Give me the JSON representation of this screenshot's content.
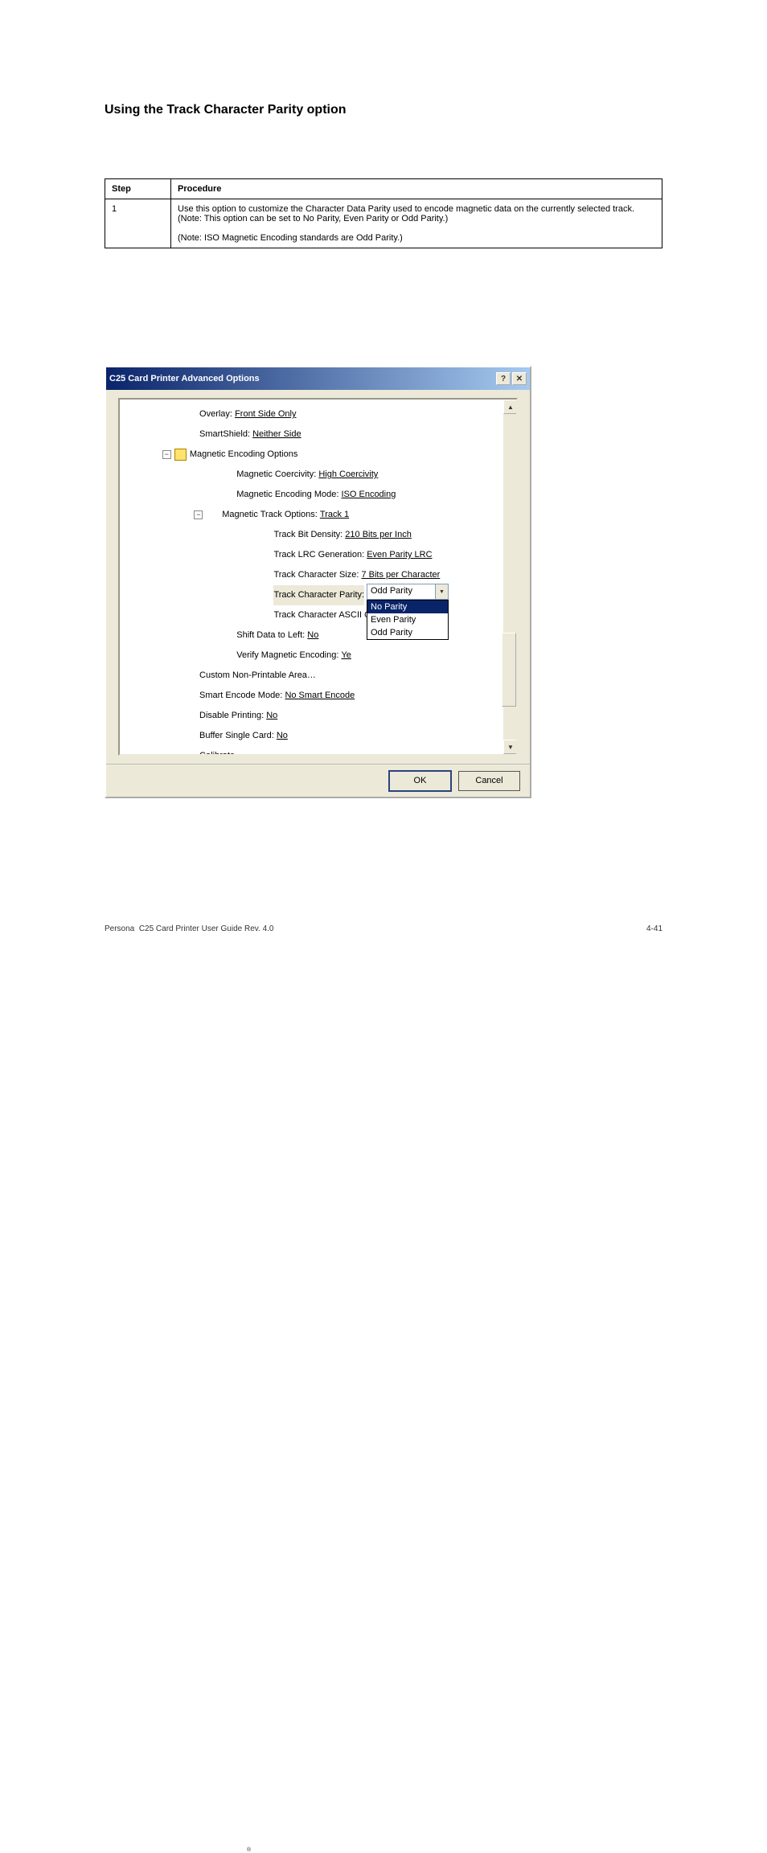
{
  "section": "Using the Track Character Parity option",
  "table": {
    "h1": "Step",
    "h2": "Procedure",
    "c1": "1",
    "c2": "Use this option to customize the Character Data Parity used to encode magnetic data on the currently selected track. (Note: This option can be set to No Parity, Even Parity or Odd Parity.)",
    "note": "(Note: ISO Magnetic Encoding standards are Odd Parity.)"
  },
  "dlg": {
    "title": "C25 Card Printer Advanced Options",
    "tree": {
      "overlay": {
        "l": "Overlay:",
        "v": "Front Side Only"
      },
      "smartshield": {
        "l": "SmartShield:",
        "v": "Neither Side"
      },
      "mag": {
        "l": "Magnetic Encoding Options"
      },
      "coerc": {
        "l": "Magnetic Coercivity:",
        "v": "High Coercivity"
      },
      "mode": {
        "l": "Magnetic Encoding Mode:",
        "v": "ISO Encoding"
      },
      "trackopt": {
        "l": "Magnetic Track Options:",
        "v": "Track 1"
      },
      "density": {
        "l": "Track Bit Density:",
        "v": "210 Bits per Inch"
      },
      "lrc": {
        "l": "Track LRC Generation:",
        "v": "Even Parity LRC"
      },
      "size": {
        "l": "Track Character Size:",
        "v": "7 Bits per Character"
      },
      "parity": {
        "l": "Track Character Parity:"
      },
      "ascii": {
        "l": "Track Character ASCII O"
      },
      "shift": {
        "l": "Shift Data to Left:",
        "v": "No"
      },
      "verify": {
        "l": "Verify Magnetic Encoding:",
        "v": "Ye"
      },
      "custom": {
        "l": "Custom Non-Printable Area…"
      },
      "smartenc": {
        "l": "Smart Encode Mode:",
        "v": "No Smart Encode"
      },
      "disable": {
        "l": "Disable Printing:",
        "v": "No"
      },
      "buffer": {
        "l": "Buffer Single Card:",
        "v": "No"
      },
      "calibrate": {
        "l": "Calibrate…"
      }
    },
    "select": {
      "value": "Odd Parity",
      "o1": "No Parity",
      "o2": "Even Parity",
      "o3": "Odd Parity"
    },
    "ok": "OK",
    "cancel": "Cancel"
  },
  "footer": {
    "l": "Persona",
    "r": "C25 Card Printer User Guide Rev. 4.0",
    "pg": "4-41"
  }
}
